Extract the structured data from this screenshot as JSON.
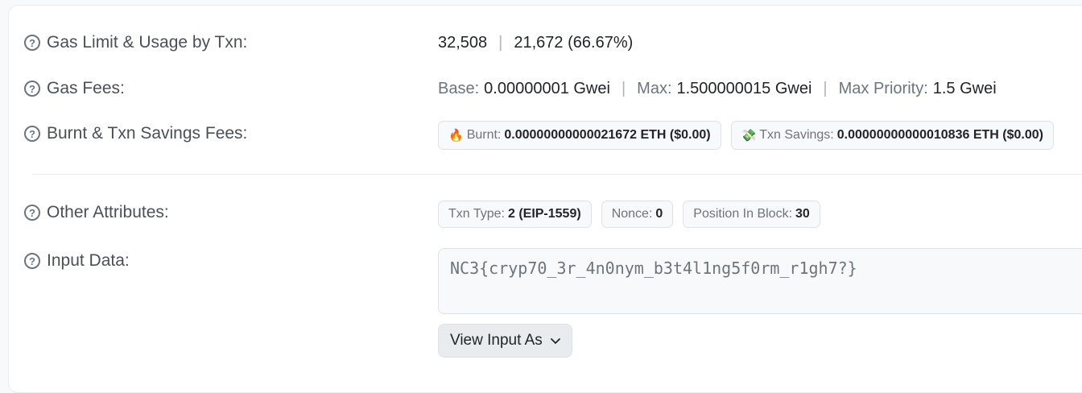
{
  "gas_limit": {
    "label": "Gas Limit & Usage by Txn:",
    "limit": "32,508",
    "separator": "|",
    "usage": "21,672 (66.67%)"
  },
  "gas_fees": {
    "label": "Gas Fees:",
    "base_label": "Base:",
    "base_value": "0.00000001 Gwei",
    "max_label": "Max:",
    "max_value": "1.500000015 Gwei",
    "max_priority_label": "Max Priority:",
    "max_priority_value": "1.5 Gwei",
    "separator": "|"
  },
  "burnt_fees": {
    "label": "Burnt & Txn Savings Fees:",
    "burnt_emoji": "🔥",
    "burnt_label": "Burnt:",
    "burnt_value": "0.00000000000021672 ETH ($0.00)",
    "savings_emoji": "💸",
    "savings_label": "Txn Savings:",
    "savings_value": "0.00000000000010836 ETH ($0.00)"
  },
  "other_attributes": {
    "label": "Other Attributes:",
    "txn_type_label": "Txn Type:",
    "txn_type_value": "2 (EIP-1559)",
    "nonce_label": "Nonce:",
    "nonce_value": "0",
    "position_label": "Position In Block:",
    "position_value": "30"
  },
  "input_data": {
    "label": "Input Data:",
    "value": "NC3{cryp70_3r_4n0nym_b3t4l1ng5f0rm_r1gh7?}",
    "view_button": "View Input As"
  },
  "colors": {
    "text": "#212529",
    "muted": "#6c757d",
    "pill_bg": "#f8f9fa",
    "border": "#dee2e6"
  }
}
